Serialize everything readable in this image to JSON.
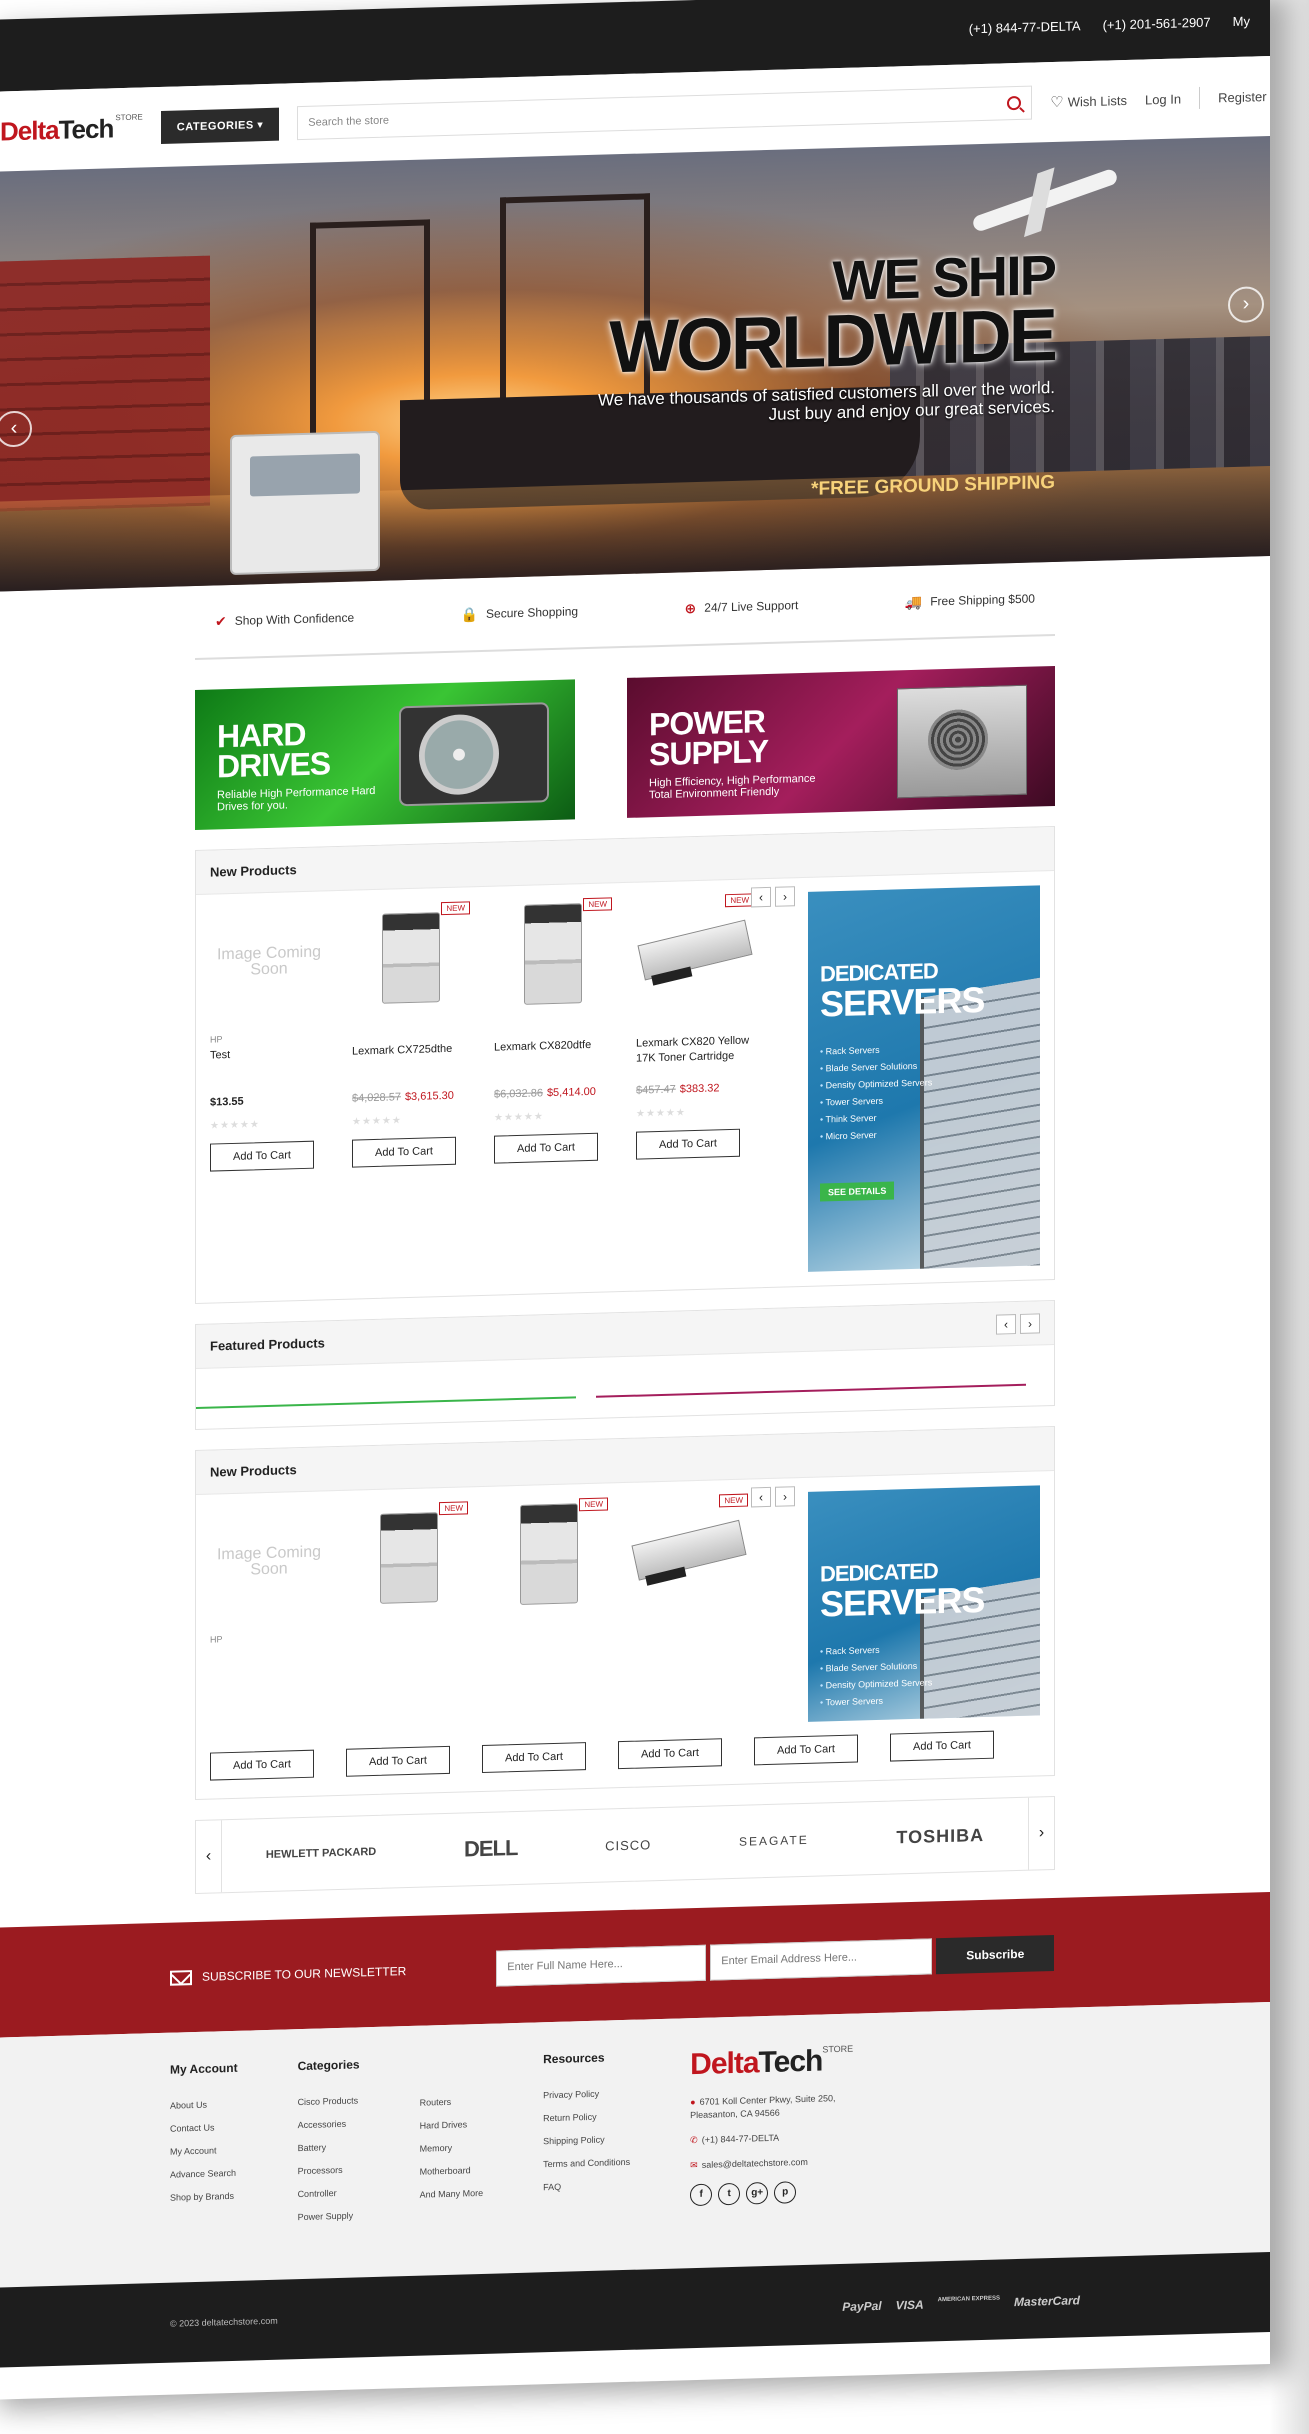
{
  "topbar": {
    "phone1": "(+1) 844-77-DELTA",
    "phone2": "(+1) 201-561-2907",
    "account": "My"
  },
  "header": {
    "logo_part1": "Delta",
    "logo_part2": "Tech",
    "logo_store": "STORE",
    "categories_label": "CATEGORIES",
    "search_placeholder": "Search the store",
    "wishlist": "Wish Lists",
    "login": "Log In",
    "register": "Register"
  },
  "hero": {
    "title_line1": "WE SHIP",
    "title_line2": "WORLDWIDE",
    "subtitle_line1": "We have thousands of satisfied customers all over the world.",
    "subtitle_line2": "Just buy and enjoy our great services.",
    "shipping_label": "*FREE GROUND SHIPPING"
  },
  "features": [
    {
      "label": "Shop With Confidence",
      "icon": "✔"
    },
    {
      "label": "Secure Shopping",
      "icon": "🔒"
    },
    {
      "label": "24/7 Live Support",
      "icon": "⊕"
    },
    {
      "label": "Free Shipping $500",
      "icon": "🚚"
    }
  ],
  "banners": {
    "hdd_title_line1": "HARD",
    "hdd_title_line2": "DRIVES",
    "hdd_sub_line1": "Reliable High Performance Hard",
    "hdd_sub_line2": "Drives for you.",
    "psu_title_line1": "POWER",
    "psu_title_line2": "SUPPLY",
    "psu_sub_line1": "High Efficiency, High Performance",
    "psu_sub_line2": "Total Environment Friendly"
  },
  "new_products": {
    "title": "New Products",
    "items": [
      {
        "image_placeholder": "Image Coming Soon",
        "brand": "HP",
        "name": "Test",
        "old_price": "",
        "price": "$13.55",
        "badge": "",
        "cart": "Add To Cart"
      },
      {
        "image_placeholder": "",
        "brand": "",
        "name": "Lexmark CX725dthe",
        "old_price": "$4,028.57",
        "price": "$3,615.30",
        "badge": "NEW",
        "cart": "Add To Cart"
      },
      {
        "image_placeholder": "",
        "brand": "",
        "name": "Lexmark CX820dtfe",
        "old_price": "$6,032.86",
        "price": "$5,414.00",
        "badge": "NEW",
        "cart": "Add To Cart"
      },
      {
        "image_placeholder": "",
        "brand": "",
        "name": "Lexmark CX820 Yellow 17K Toner Cartridge",
        "old_price": "$457.47",
        "price": "$383.32",
        "badge": "NEW",
        "cart": "Add To Cart"
      }
    ]
  },
  "promo": {
    "title1": "DEDICATED",
    "title2": "SERVERS",
    "features": [
      "Rack Servers",
      "Blade Server Solutions",
      "Density Optimized Servers",
      "Tower Servers",
      "Think Server",
      "Micro Server"
    ],
    "cta": "SEE DETAILS"
  },
  "featured": {
    "title": "Featured Products"
  },
  "new_products_2": {
    "title": "New Products",
    "brand": "HP",
    "image_placeholder": "Image Coming Soon",
    "badge": "NEW",
    "cart_labels": [
      "Add To Cart",
      "Add To Cart",
      "Add To Cart",
      "Add To Cart",
      "Add To Cart",
      "Add To Cart"
    ]
  },
  "brands": [
    "HEWLETT PACKARD",
    "DELL",
    "CISCO",
    "SEAGATE",
    "TOSHIBA"
  ],
  "newsletter": {
    "title": "SUBSCRIBE TO OUR NEWSLETTER",
    "name_placeholder": "Enter Full Name Here...",
    "email_placeholder": "Enter Email Address Here...",
    "button": "Subscribe"
  },
  "footer": {
    "account_title": "My Account",
    "account_links": [
      "About Us",
      "Contact Us",
      "My Account",
      "Advance Search",
      "Shop by Brands"
    ],
    "categories_title": "Categories",
    "categories_col1": [
      "Cisco Products",
      "Accessories",
      "Battery",
      "Processors",
      "Controller",
      "Power Supply"
    ],
    "categories_col2": [
      "Routers",
      "Hard Drives",
      "Memory",
      "Motherboard",
      "And Many More"
    ],
    "resources_title": "Resources",
    "resources_links": [
      "Privacy Policy",
      "Return Policy",
      "Shipping Policy",
      "Terms and Conditions",
      "FAQ"
    ],
    "address_line1": "6701 Koll Center Pkwy, Suite 250,",
    "address_line2": "Pleasanton, CA 94566",
    "phone": "(+1) 844-77-DELTA",
    "email": "sales@deltatechstore.com",
    "socials": [
      "f",
      "t",
      "g+",
      "p"
    ]
  },
  "bottom": {
    "copyright": "© 2023 deltatechstore.com",
    "payments": [
      "PayPal",
      "VISA",
      "AMERICAN EXPRESS",
      "MasterCard"
    ]
  }
}
